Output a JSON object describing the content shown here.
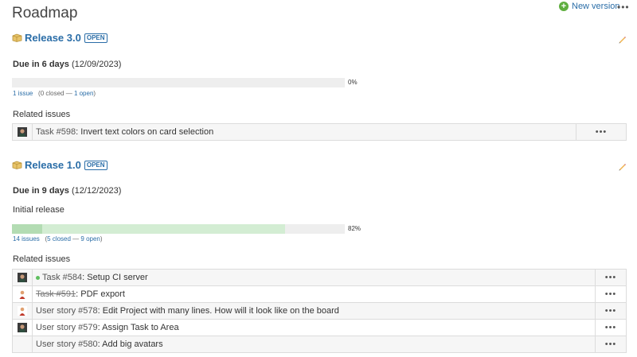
{
  "page": {
    "title": "Roadmap",
    "new_version_label": "New version",
    "more_label": "•••"
  },
  "versions": [
    {
      "name": "Release 3.0",
      "status": "OPEN",
      "due_label": "Due in 6 days",
      "due_date": "(12/09/2023)",
      "description": "",
      "progress_closed": 0,
      "progress_done": 0,
      "percent": "0%",
      "issues_link": "1 issue",
      "counts_open_paren": "(0 closed — ",
      "open_link": "1 open",
      "counts_close_paren": ")",
      "related_label": "Related issues",
      "issues": [
        {
          "tracker": "Task #598",
          "subject": ": Invert text colors on card selection",
          "closed": false,
          "dot": false,
          "avatar": "photo"
        }
      ]
    },
    {
      "name": "Release 1.0",
      "status": "OPEN",
      "due_label": "Due in 9 days",
      "due_date": "(12/12/2023)",
      "description": "Initial release",
      "progress_closed": 0.09,
      "progress_done": 0.82,
      "percent": "82%",
      "issues_link": "14 issues",
      "counts_open_paren": "(",
      "closed_link": "5 closed",
      "counts_mid": " — ",
      "open_link": "9 open",
      "counts_close_paren": ")",
      "related_label": "Related issues",
      "issues": [
        {
          "tracker": "Task #584",
          "subject": ": Setup CI server",
          "closed": false,
          "dot": true,
          "avatar": "photo"
        },
        {
          "tracker": "Task #591",
          "subject": ": PDF export",
          "closed": true,
          "dot": false,
          "avatar": "person"
        },
        {
          "tracker": "User story #578",
          "subject": ": Edit Project with many lines. How will it look like on the board",
          "closed": false,
          "dot": false,
          "avatar": "person"
        },
        {
          "tracker": "User story #579",
          "subject": ": Assign Task to Area",
          "closed": false,
          "dot": false,
          "avatar": "photo"
        },
        {
          "tracker": "User story #580",
          "subject": ": Add big avatars",
          "closed": false,
          "dot": false,
          "avatar": "none"
        }
      ]
    }
  ],
  "colors": {
    "link": "#2a6da7",
    "progress_closed": "#b3dcb3",
    "progress_done": "#d3edd3",
    "progress_track": "#eeeeee"
  }
}
